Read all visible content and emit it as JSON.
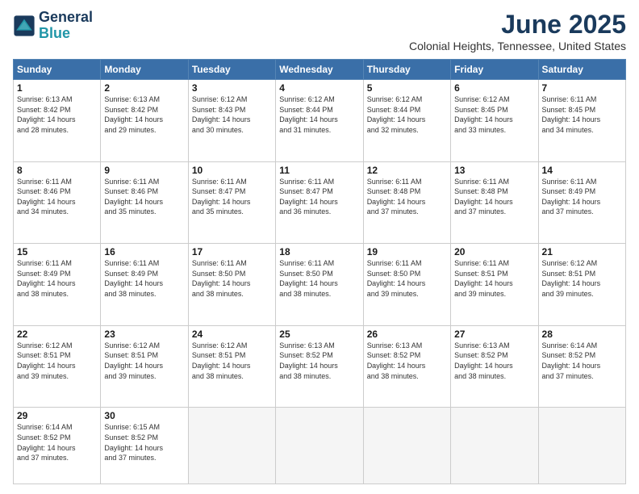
{
  "header": {
    "logo_line1": "General",
    "logo_line2": "Blue",
    "month": "June 2025",
    "location": "Colonial Heights, Tennessee, United States"
  },
  "weekdays": [
    "Sunday",
    "Monday",
    "Tuesday",
    "Wednesday",
    "Thursday",
    "Friday",
    "Saturday"
  ],
  "weeks": [
    [
      {
        "day": "1",
        "lines": [
          "Sunrise: 6:13 AM",
          "Sunset: 8:42 PM",
          "Daylight: 14 hours",
          "and 28 minutes."
        ]
      },
      {
        "day": "2",
        "lines": [
          "Sunrise: 6:13 AM",
          "Sunset: 8:42 PM",
          "Daylight: 14 hours",
          "and 29 minutes."
        ]
      },
      {
        "day": "3",
        "lines": [
          "Sunrise: 6:12 AM",
          "Sunset: 8:43 PM",
          "Daylight: 14 hours",
          "and 30 minutes."
        ]
      },
      {
        "day": "4",
        "lines": [
          "Sunrise: 6:12 AM",
          "Sunset: 8:44 PM",
          "Daylight: 14 hours",
          "and 31 minutes."
        ]
      },
      {
        "day": "5",
        "lines": [
          "Sunrise: 6:12 AM",
          "Sunset: 8:44 PM",
          "Daylight: 14 hours",
          "and 32 minutes."
        ]
      },
      {
        "day": "6",
        "lines": [
          "Sunrise: 6:12 AM",
          "Sunset: 8:45 PM",
          "Daylight: 14 hours",
          "and 33 minutes."
        ]
      },
      {
        "day": "7",
        "lines": [
          "Sunrise: 6:11 AM",
          "Sunset: 8:45 PM",
          "Daylight: 14 hours",
          "and 34 minutes."
        ]
      }
    ],
    [
      {
        "day": "8",
        "lines": [
          "Sunrise: 6:11 AM",
          "Sunset: 8:46 PM",
          "Daylight: 14 hours",
          "and 34 minutes."
        ]
      },
      {
        "day": "9",
        "lines": [
          "Sunrise: 6:11 AM",
          "Sunset: 8:46 PM",
          "Daylight: 14 hours",
          "and 35 minutes."
        ]
      },
      {
        "day": "10",
        "lines": [
          "Sunrise: 6:11 AM",
          "Sunset: 8:47 PM",
          "Daylight: 14 hours",
          "and 35 minutes."
        ]
      },
      {
        "day": "11",
        "lines": [
          "Sunrise: 6:11 AM",
          "Sunset: 8:47 PM",
          "Daylight: 14 hours",
          "and 36 minutes."
        ]
      },
      {
        "day": "12",
        "lines": [
          "Sunrise: 6:11 AM",
          "Sunset: 8:48 PM",
          "Daylight: 14 hours",
          "and 37 minutes."
        ]
      },
      {
        "day": "13",
        "lines": [
          "Sunrise: 6:11 AM",
          "Sunset: 8:48 PM",
          "Daylight: 14 hours",
          "and 37 minutes."
        ]
      },
      {
        "day": "14",
        "lines": [
          "Sunrise: 6:11 AM",
          "Sunset: 8:49 PM",
          "Daylight: 14 hours",
          "and 37 minutes."
        ]
      }
    ],
    [
      {
        "day": "15",
        "lines": [
          "Sunrise: 6:11 AM",
          "Sunset: 8:49 PM",
          "Daylight: 14 hours",
          "and 38 minutes."
        ]
      },
      {
        "day": "16",
        "lines": [
          "Sunrise: 6:11 AM",
          "Sunset: 8:49 PM",
          "Daylight: 14 hours",
          "and 38 minutes."
        ]
      },
      {
        "day": "17",
        "lines": [
          "Sunrise: 6:11 AM",
          "Sunset: 8:50 PM",
          "Daylight: 14 hours",
          "and 38 minutes."
        ]
      },
      {
        "day": "18",
        "lines": [
          "Sunrise: 6:11 AM",
          "Sunset: 8:50 PM",
          "Daylight: 14 hours",
          "and 38 minutes."
        ]
      },
      {
        "day": "19",
        "lines": [
          "Sunrise: 6:11 AM",
          "Sunset: 8:50 PM",
          "Daylight: 14 hours",
          "and 39 minutes."
        ]
      },
      {
        "day": "20",
        "lines": [
          "Sunrise: 6:11 AM",
          "Sunset: 8:51 PM",
          "Daylight: 14 hours",
          "and 39 minutes."
        ]
      },
      {
        "day": "21",
        "lines": [
          "Sunrise: 6:12 AM",
          "Sunset: 8:51 PM",
          "Daylight: 14 hours",
          "and 39 minutes."
        ]
      }
    ],
    [
      {
        "day": "22",
        "lines": [
          "Sunrise: 6:12 AM",
          "Sunset: 8:51 PM",
          "Daylight: 14 hours",
          "and 39 minutes."
        ]
      },
      {
        "day": "23",
        "lines": [
          "Sunrise: 6:12 AM",
          "Sunset: 8:51 PM",
          "Daylight: 14 hours",
          "and 39 minutes."
        ]
      },
      {
        "day": "24",
        "lines": [
          "Sunrise: 6:12 AM",
          "Sunset: 8:51 PM",
          "Daylight: 14 hours",
          "and 38 minutes."
        ]
      },
      {
        "day": "25",
        "lines": [
          "Sunrise: 6:13 AM",
          "Sunset: 8:52 PM",
          "Daylight: 14 hours",
          "and 38 minutes."
        ]
      },
      {
        "day": "26",
        "lines": [
          "Sunrise: 6:13 AM",
          "Sunset: 8:52 PM",
          "Daylight: 14 hours",
          "and 38 minutes."
        ]
      },
      {
        "day": "27",
        "lines": [
          "Sunrise: 6:13 AM",
          "Sunset: 8:52 PM",
          "Daylight: 14 hours",
          "and 38 minutes."
        ]
      },
      {
        "day": "28",
        "lines": [
          "Sunrise: 6:14 AM",
          "Sunset: 8:52 PM",
          "Daylight: 14 hours",
          "and 37 minutes."
        ]
      }
    ],
    [
      {
        "day": "29",
        "lines": [
          "Sunrise: 6:14 AM",
          "Sunset: 8:52 PM",
          "Daylight: 14 hours",
          "and 37 minutes."
        ]
      },
      {
        "day": "30",
        "lines": [
          "Sunrise: 6:15 AM",
          "Sunset: 8:52 PM",
          "Daylight: 14 hours",
          "and 37 minutes."
        ]
      },
      {
        "day": "",
        "lines": []
      },
      {
        "day": "",
        "lines": []
      },
      {
        "day": "",
        "lines": []
      },
      {
        "day": "",
        "lines": []
      },
      {
        "day": "",
        "lines": []
      }
    ]
  ]
}
